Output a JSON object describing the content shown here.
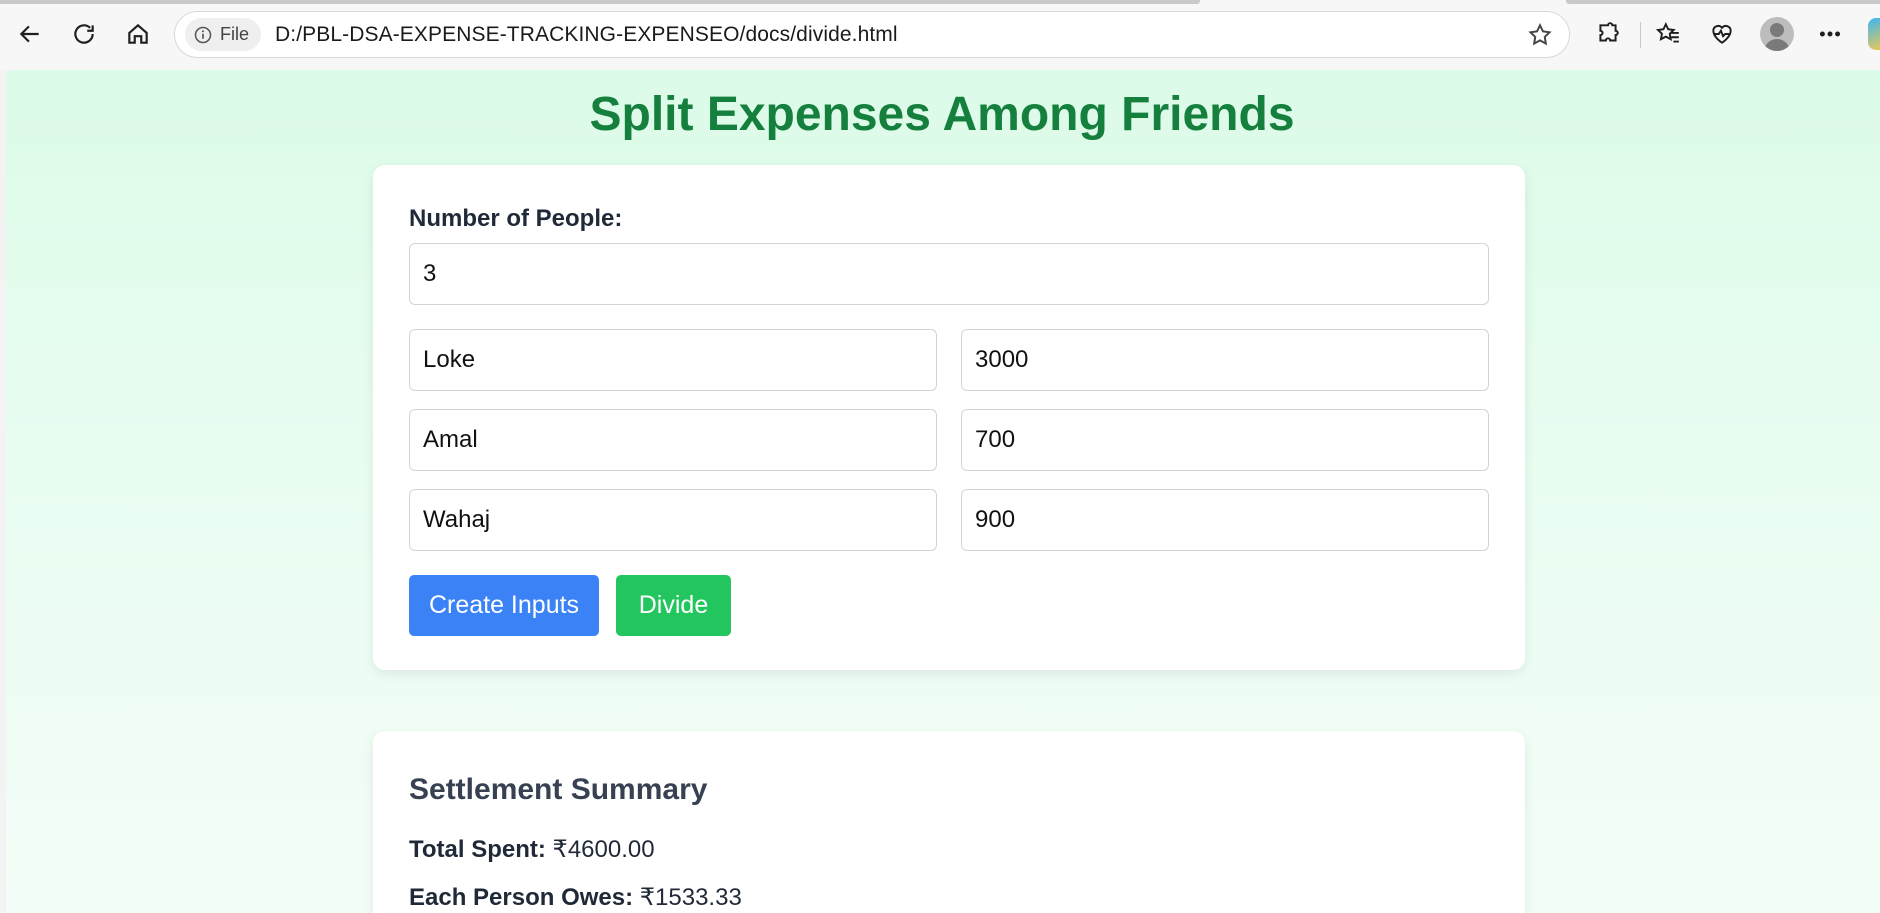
{
  "browser": {
    "site_info_label": "File",
    "url": "D:/PBL-DSA-EXPENSE-TRACKING-EXPENSEO/docs/divide.html"
  },
  "page": {
    "title": "Split Expenses Among Friends"
  },
  "form": {
    "people_label": "Number of People:",
    "people_count": "3",
    "people": [
      {
        "name": "Loke",
        "amount": "3000"
      },
      {
        "name": "Amal",
        "amount": "700"
      },
      {
        "name": "Wahaj",
        "amount": "900"
      }
    ],
    "create_button": "Create Inputs",
    "divide_button": "Divide"
  },
  "summary": {
    "title": "Settlement Summary",
    "total_label": "Total Spent:",
    "total_value": "₹4600.00",
    "each_label": "Each Person Owes:",
    "each_value": "₹1533.33"
  },
  "colors": {
    "title_green": "#15803d",
    "create_blue": "#3b82f6",
    "divide_green": "#22c55e",
    "page_bg": "#dcfbe8"
  }
}
